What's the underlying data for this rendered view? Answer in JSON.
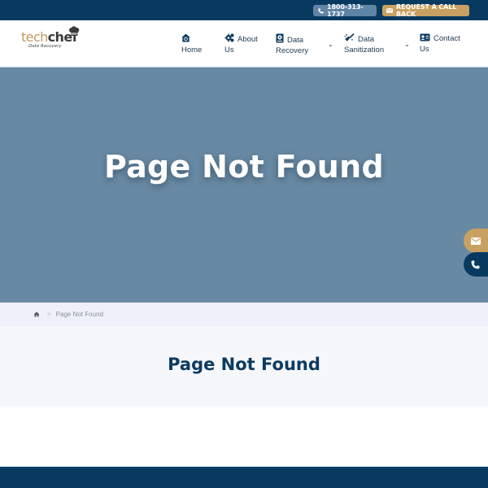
{
  "topbar": {
    "phone_label": "1800-313-1737",
    "callback_label": "REQUEST A CALL BACK"
  },
  "logo": {
    "part1": "tech",
    "part2": "chef",
    "tagline": "Data Recovery"
  },
  "nav": {
    "items": [
      {
        "label_line1": "",
        "label_line2": "Home",
        "icon": "home-icon"
      },
      {
        "label_line1": "About",
        "label_line2": "Us",
        "icon": "gears-icon"
      },
      {
        "label_line1": "Data",
        "label_line2": "Recovery",
        "icon": "hard-drive-icon",
        "has_dropdown": true
      },
      {
        "label_line1": "Data",
        "label_line2": "Sanitization",
        "icon": "broom-icon",
        "has_dropdown": true
      },
      {
        "label_line1": "Contact",
        "label_line2": "Us",
        "icon": "contact-card-icon"
      }
    ]
  },
  "hero": {
    "title": "Page Not Found"
  },
  "breadcrumb": {
    "separator": ">",
    "current": "Page Not Found"
  },
  "main": {
    "title": "Page Not Found"
  },
  "colors": {
    "primary": "#083a60",
    "accent": "#c8a162",
    "hero_bg": "#6889a3",
    "phone_pill": "#5e84a6"
  }
}
